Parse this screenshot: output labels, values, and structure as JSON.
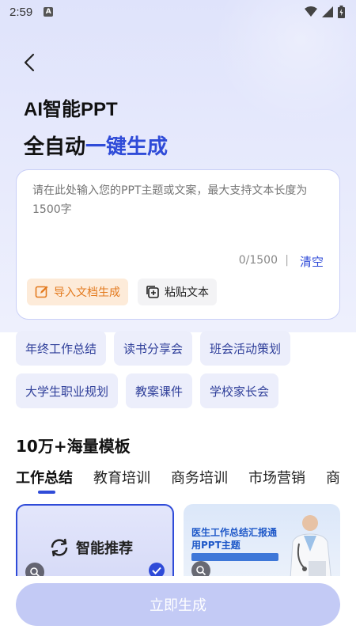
{
  "status_bar": {
    "time": "2:59",
    "indicator": "A",
    "icons": [
      "wifi-icon",
      "signal-icon",
      "battery-icon"
    ]
  },
  "header": {
    "back_icon": "chevron-left-icon",
    "title_line1": "AI智能PPT",
    "title_line2_plain": "全自动",
    "title_line2_accent": "一键生成"
  },
  "input": {
    "placeholder": "请在此处输入您的PPT主题或文案，最大支持文本长度为1500字",
    "value": "",
    "counter": "0/1500",
    "separator": "|",
    "clear_label": "清空",
    "import_label": "导入文档生成",
    "import_icon": "edit-doc-icon",
    "paste_label": "粘贴文本",
    "paste_icon": "paste-plus-icon"
  },
  "topic_chips": [
    "年终工作总结",
    "读书分享会",
    "班会活动策划",
    "大学生职业规划",
    "教案课件",
    "学校家长会"
  ],
  "templates": {
    "section_title": "10万+海量模板",
    "tabs": [
      "工作总结",
      "教育培训",
      "商务培训",
      "市场营销",
      "商"
    ],
    "active_tab": 0,
    "smart_card_label": "智能推荐",
    "smart_card_icon": "refresh-icon",
    "template_card_title": "医生工作总结汇报通用PPT主题"
  },
  "footer": {
    "generate_label": "立即生成"
  },
  "colors": {
    "accent": "#2f4bd8",
    "chip_bg": "#eceefb",
    "generate_bg": "#c3caf5",
    "import_text": "#e37a1e"
  }
}
